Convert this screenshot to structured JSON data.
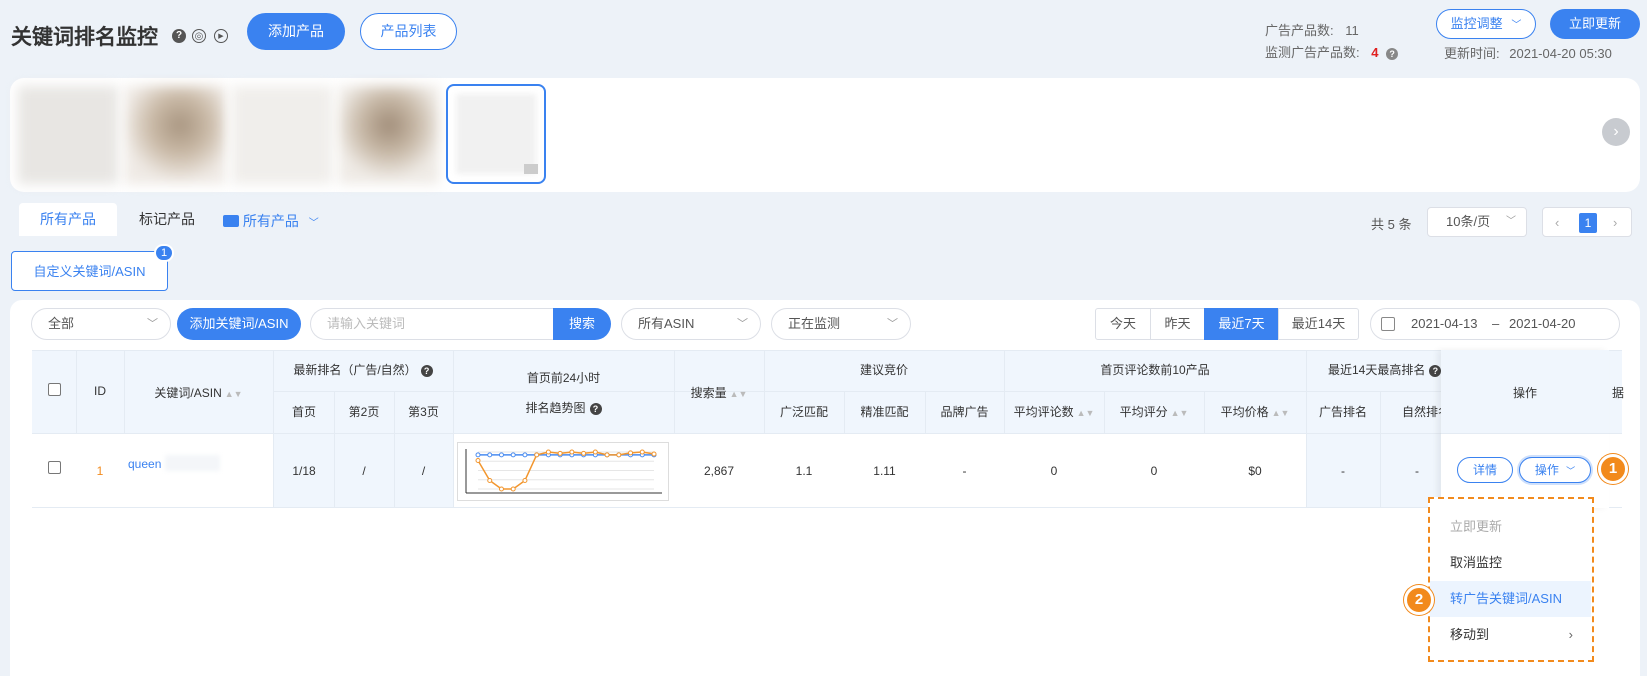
{
  "header": {
    "title": "关键词排名监控",
    "add_product": "添加产品",
    "product_list": "产品列表",
    "ad_products_label": "广告产品数:",
    "ad_products_value": "11",
    "monitored_label": "监测广告产品数:",
    "monitored_value": "4",
    "monitor_adjust": "监控调整",
    "update_now": "立即更新",
    "update_time_label": "更新时间:",
    "update_time_value": "2021-04-20 05:30"
  },
  "tabs": {
    "all_products": "所有产品",
    "marked_products": "标记产品",
    "folder": "所有产品"
  },
  "pagination": {
    "total": "共 5 条",
    "per_page": "10条/页",
    "current": "1"
  },
  "custom_keyword": {
    "label": "自定义关键词/ASIN",
    "badge": "1"
  },
  "filters": {
    "scope": "全部",
    "add_keyword": "添加关键词/ASIN",
    "search_placeholder": "请输入关键词",
    "search_btn": "搜索",
    "asin_select": "所有ASIN",
    "status_select": "正在监测",
    "ranges": [
      "今天",
      "昨天",
      "最近7天",
      "最近14天"
    ],
    "date_start": "2021-04-13",
    "date_sep": "–",
    "date_end": "2021-04-20"
  },
  "table": {
    "headers": {
      "id": "ID",
      "keyword": "关键词/ASIN",
      "latest_rank": "最新排名（广告/自然）",
      "page1": "首页",
      "page2": "第2页",
      "page3": "第3页",
      "trend_line1": "首页前24小时",
      "trend_line2": "排名趋势图",
      "search_volume": "搜索量",
      "suggested_bid": "建议竞价",
      "broad": "广泛匹配",
      "exact": "精准匹配",
      "brand_ad": "品牌广告",
      "top10": "首页评论数前10产品",
      "avg_reviews": "平均评论数",
      "avg_rating": "平均评分",
      "avg_price": "平均价格",
      "best14": "最近14天最高排名",
      "ad_rank": "广告排名",
      "natural_rank": "自然排名",
      "actions": "操作",
      "extra": "据"
    },
    "rows": [
      {
        "id": "1",
        "keyword": "queen",
        "page1": "1/18",
        "page2": "/",
        "page3": "/",
        "search_volume": "2,867",
        "broad": "1.1",
        "exact": "1.11",
        "brand_ad": "-",
        "avg_reviews": "0",
        "avg_rating": "0",
        "avg_price": "$0",
        "ad_rank": "-",
        "natural_rank": "-",
        "detail_btn": "详情",
        "ops_btn": "操作"
      }
    ]
  },
  "chart_data": {
    "type": "line",
    "series": [
      {
        "color": "#4a8cf0",
        "values": [
          1,
          1,
          1,
          1,
          1,
          1,
          1,
          1,
          1,
          1,
          1,
          1,
          1,
          1,
          1,
          1
        ]
      },
      {
        "color": "#f2962e",
        "values": [
          3,
          10,
          13,
          13,
          10,
          1,
          0,
          0.5,
          0,
          0.5,
          0,
          1,
          1,
          0.3,
          0,
          0.7
        ]
      }
    ]
  },
  "dropdown": {
    "items": [
      "立即更新",
      "取消监控",
      "转广告关键词/ASIN",
      "移动到"
    ]
  },
  "markers": {
    "one": "1",
    "two": "2"
  },
  "colors": {
    "primary": "#3a82f0",
    "accent_orange": "#f28a1c",
    "alert_red": "#e02020"
  }
}
